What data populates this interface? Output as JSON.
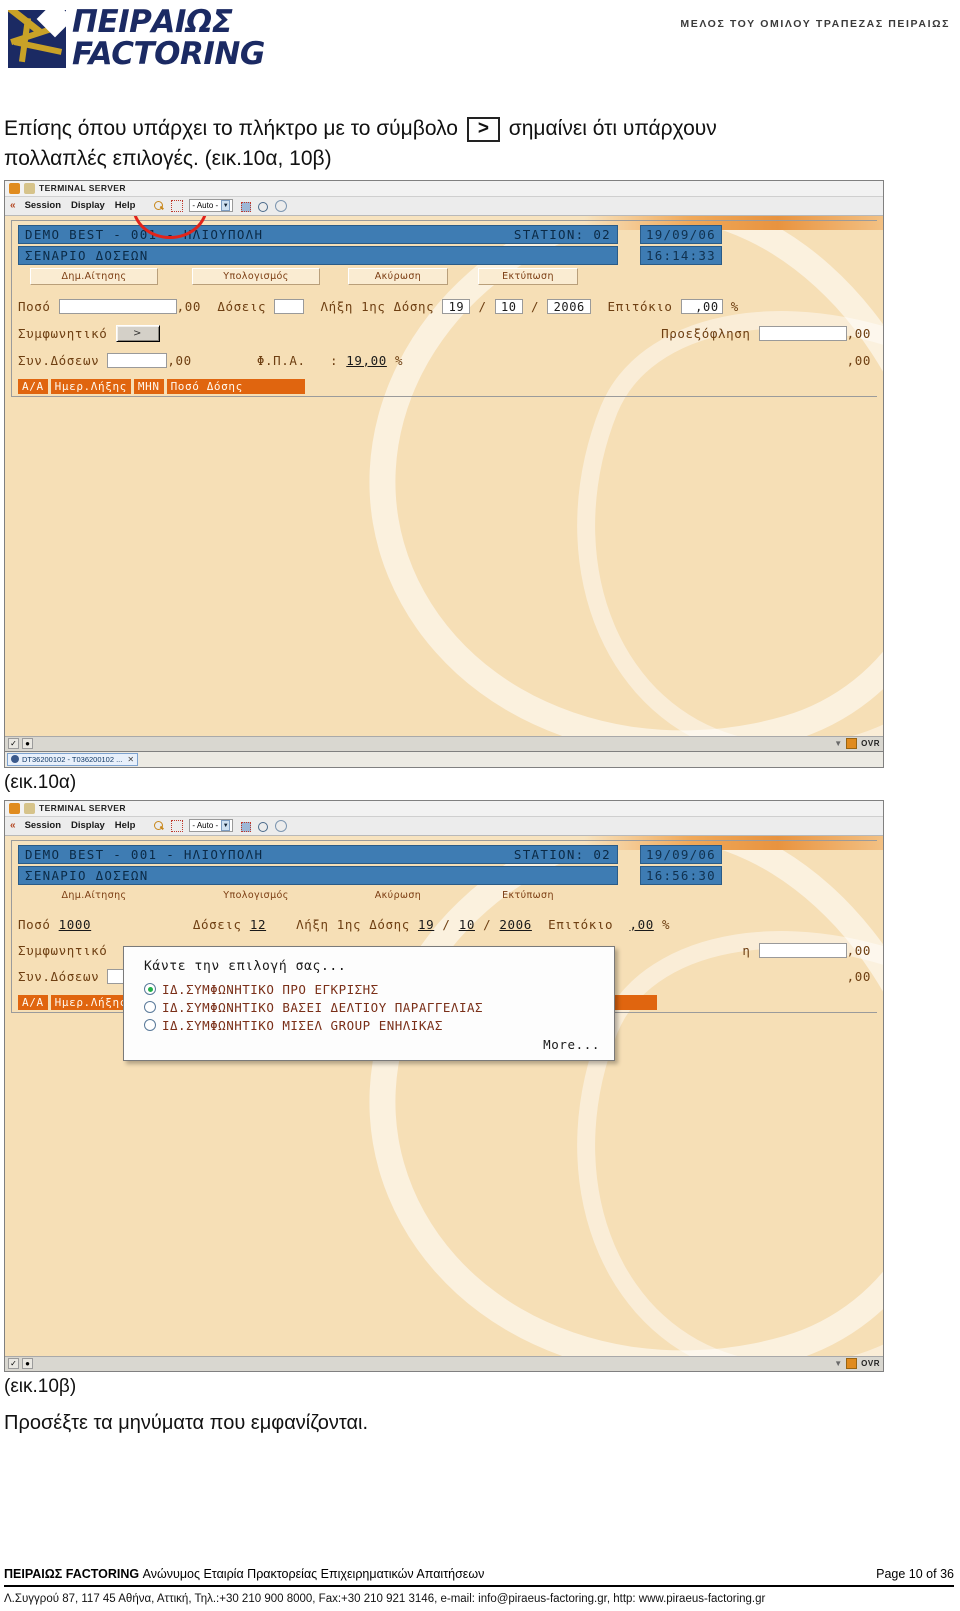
{
  "header": {
    "logo_line1": "ΠΕΙΡΑΙΩΣ",
    "logo_line2": "FACTORING",
    "member_line": "ΜΕΛΟΣ ΤΟΥ ΟΜΙΛΟΥ ΤΡΑΠΕΖΑΣ ΠΕΙΡΑΙΩΣ"
  },
  "intro": {
    "part1": "Επίσης όπου υπάρχει το πλήκτρο με το σύμβολο",
    "key_symbol": ">",
    "part2": "σημαίνει ότι υπάρχουν",
    "part3": "πολλαπλές επιλογές. (εικ.10α, 10β)"
  },
  "terminal": {
    "window_title": "TERMINAL SERVER",
    "menu": [
      "Session",
      "Display",
      "Help"
    ],
    "zoom_select": "- Auto -",
    "header_left": "DEMO BEST - 001 - ΗΛΙΟΥΠΟΛΗ",
    "header_right": "STATION: 02",
    "subtitle": "ΣΕΝΑΡΙΟ ΔΟΣΕΩΝ",
    "date": "19/09/06",
    "buttons": [
      "Δημ.Αίτησης",
      "Υπολογισμός",
      "Ακύρωση",
      "Εκτύπωση"
    ],
    "status_ovr": "OVR",
    "taskbar_item": "DT36200102 - T036200102 ..."
  },
  "shot_a": {
    "time": "16:14:33",
    "labels": {
      "amount": "Ποσό",
      "amount_suffix": ",00",
      "doses": "Δόσεις",
      "expiry": "Λήξη 1ης Δόσης",
      "slash": "/",
      "interest": "Επιτόκιο",
      "interest_value": ",00",
      "percent": "%",
      "contract": "Συμφωνητικό",
      "gt_button": ">",
      "prepay": "Προεξόφληση",
      "prepay_value": ",00",
      "sum_doses": "Συν.Δόσεων",
      "sum_suffix": ",00",
      "vat": "Φ.Π.Α.",
      "vat_colon": ":",
      "vat_value": "19,00",
      "vat_percent": "%",
      "right_total": ",00"
    },
    "values": {
      "amount": "",
      "doses": "",
      "day": "19",
      "month": "10",
      "year": "2006",
      "prepay": "",
      "sum_doses": ""
    },
    "columns": [
      "A/A",
      "Ημερ.Λήξης",
      "ΜΗΝ",
      "Ποσό Δόσης"
    ],
    "caption": "(εικ.10α)"
  },
  "shot_b": {
    "time": "16:56:30",
    "values": {
      "amount": "1000",
      "doses": "12",
      "day": "19",
      "month": "10",
      "year": "2006"
    },
    "dialog": {
      "title": "Κάντε την επιλογή σας...",
      "options": [
        {
          "label": "ΙΔ.ΣΥΜΦΩΝΗΤΙΚΟ ΠΡΟ ΕΓΚΡΙΣΗΣ",
          "selected": true
        },
        {
          "label": "ΙΔ.ΣΥΜΦΩΝΗΤΙΚΟ ΒΑΣΕΙ ΔΕΛΤΙΟΥ ΠΑΡΑΓΓΕΛΙΑΣ",
          "selected": false
        },
        {
          "label": "ΙΔ.ΣΥΜΦΩΝΗΤΙΚΟ ΜΙΣΕΛ GROUP ΕΝΗΛΙΚΑΣ",
          "selected": false
        }
      ],
      "more": "More..."
    },
    "caption": "(εικ.10β)"
  },
  "final_note": "Προσέξτε τα μηνύματα που εμφανίζονται.",
  "footer": {
    "company_bold": "ΠΕΙΡΑΙΩΣ FACTORING",
    "company_rest": " Ανώνυμος Εταιρία Πρακτορείας Επιχειρηματικών Απαιτήσεων",
    "page": "Page 10 of 36",
    "address": "Λ.Συγγρού 87, 117 45 Αθήνα, Αττική, Τηλ.:+30 210 900 8000, Fax:+30 210 921 3146, e-mail: info@piraeus-factoring.gr, http: www.piraeus-factoring.gr"
  }
}
